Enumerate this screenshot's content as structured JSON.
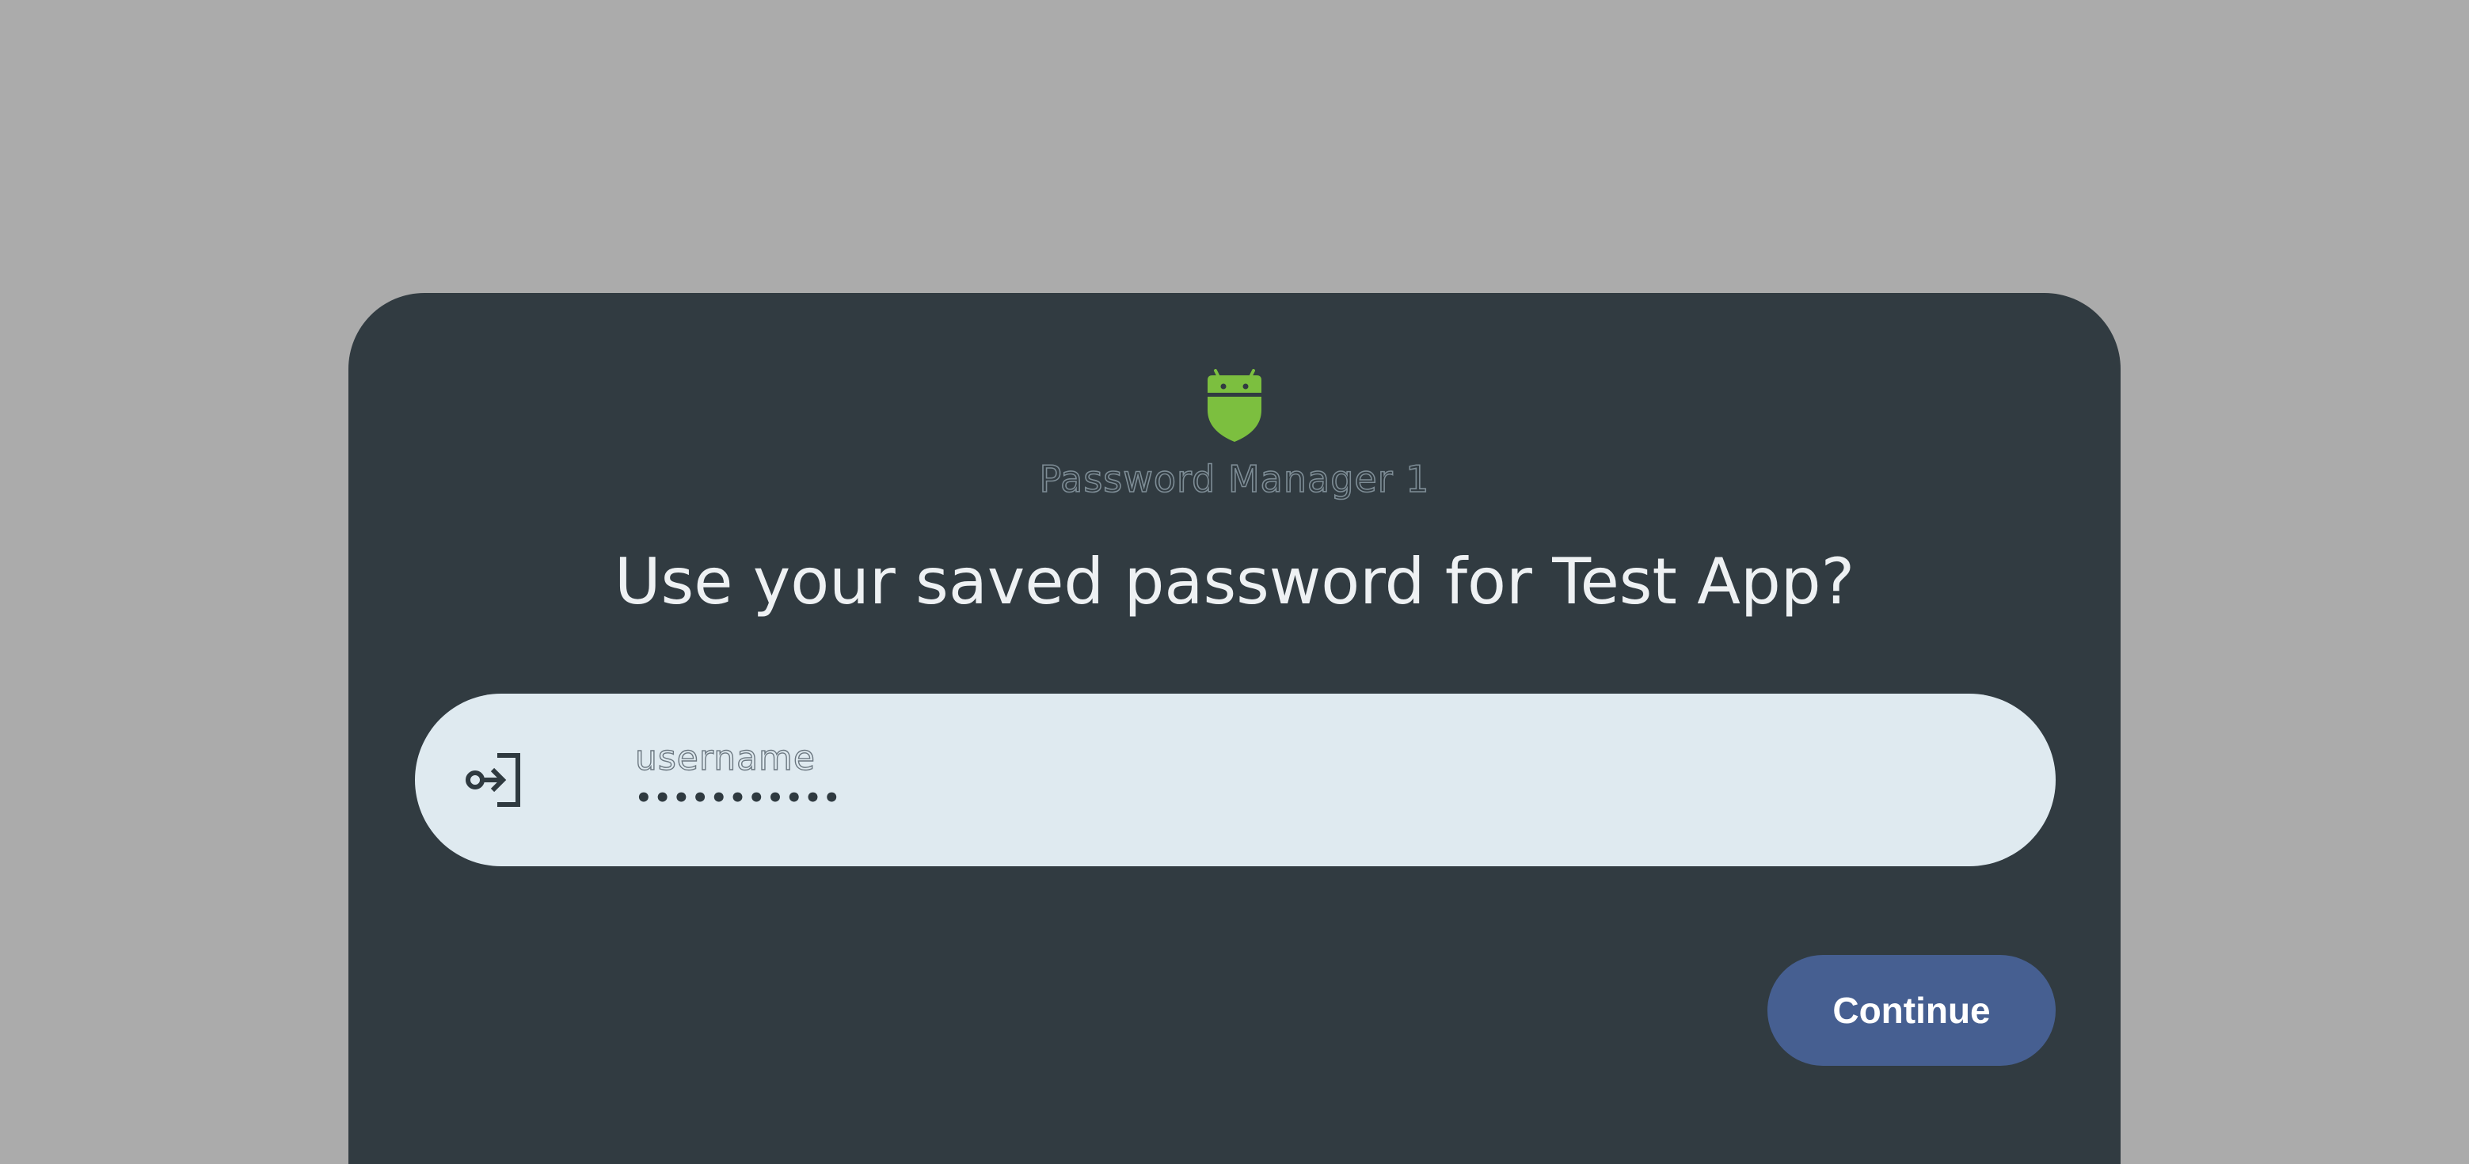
{
  "dialog": {
    "provider_name": "Password Manager 1",
    "provider_icon": "android-shield-icon",
    "title": "Use your saved password for Test App?"
  },
  "credential": {
    "icon": "login-arrow-icon",
    "username": "username",
    "password_mask": "•••••••••••"
  },
  "actions": {
    "continue_label": "Continue"
  },
  "colors": {
    "scrim": "#ababab",
    "sheet": "#313b41",
    "entry": "#dfeaf0",
    "accent": "#465f91",
    "logo_green": "#7cbf3f"
  }
}
